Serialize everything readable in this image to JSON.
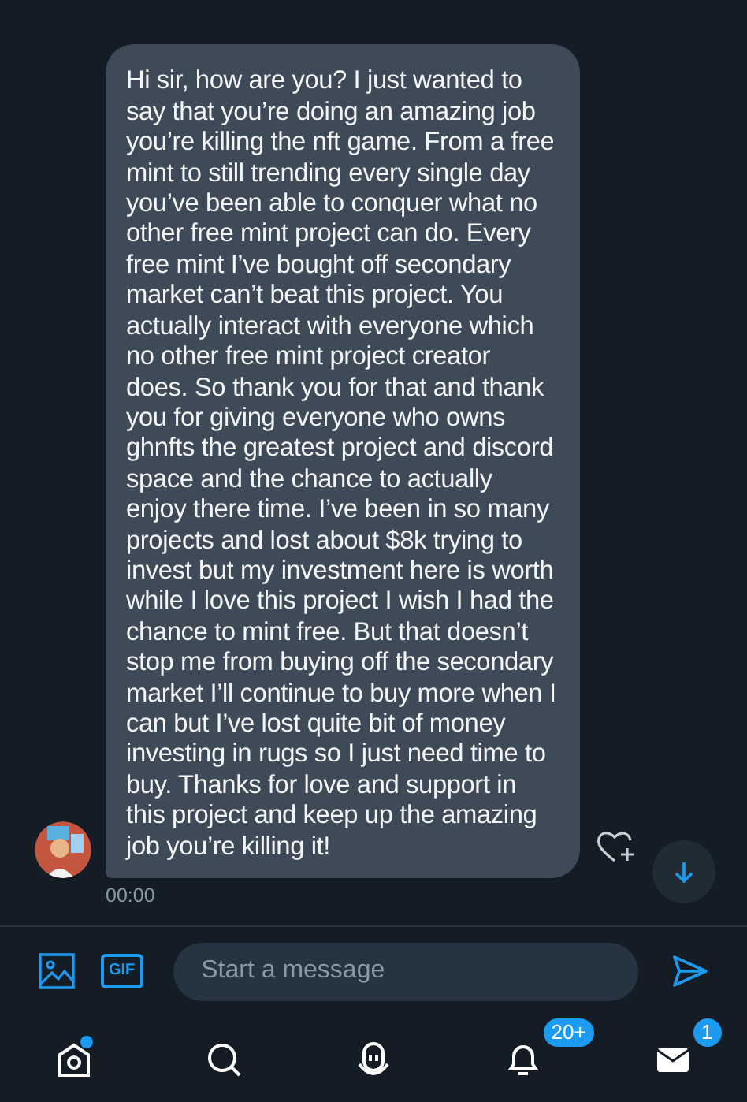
{
  "message": {
    "text": "Hi sir, how are you? I just wanted to say that you’re doing an amazing job you’re killing the nft game. From a free mint to still trending every single day you’ve been able to conquer what no other free mint project can do. Every free mint I’ve bought off secondary market can’t beat this project. You actually interact with everyone which no other free mint project creator does. So thank you for that and thank you for giving everyone who owns ghnfts the greatest project and discord space and the chance to actually enjoy there time. I’ve been in so many projects and lost about $8k trying to invest but my investment here is worth while I love this project I wish I had the chance to mint free. But that doesn’t stop me from buying off the secondary market I’ll continue to buy more when I can but I’ve lost quite bit of money investing in rugs so I just need time to buy. Thanks for love and support in this project and keep up the amazing job you’re killing it!",
    "time": "00:00"
  },
  "composer": {
    "gif": "GIF",
    "placeholder": "Start a message"
  },
  "tabs": [
    {
      "kind": "home",
      "dot": true
    },
    {
      "kind": "search",
      "dot": false
    },
    {
      "kind": "spaces",
      "dot": false
    },
    {
      "kind": "notifications",
      "dot": false,
      "badge": "20+"
    },
    {
      "kind": "messages",
      "dot": false,
      "badge": "1"
    }
  ]
}
